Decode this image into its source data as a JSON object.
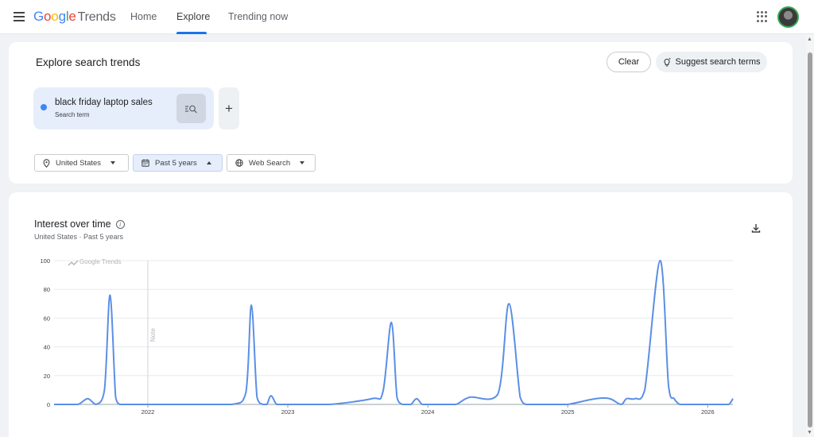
{
  "header": {
    "logo_google": "Google",
    "logo_trends": "Trends",
    "tabs": [
      {
        "label": "Home"
      },
      {
        "label": "Explore"
      },
      {
        "label": "Trending now"
      }
    ],
    "active_tab": "Explore"
  },
  "explore": {
    "title": "Explore search trends",
    "clear_label": "Clear",
    "suggest_label": "Suggest search terms",
    "term": {
      "text": "black friday laptop sales",
      "subtitle": "Search term",
      "color": "#4285f4"
    },
    "filters": {
      "location": "United States",
      "period": "Past 5 years",
      "property": "Web Search"
    }
  },
  "interest": {
    "title": "Interest over time",
    "subtitle": "United States · Past 5 years",
    "watermark": "Google Trends",
    "note_label": "Note"
  },
  "colors": {
    "accent": "#1a73e8",
    "series": "#5b8fe6",
    "grid": "#e8eaed"
  },
  "chart_data": {
    "type": "line",
    "ylim": [
      0,
      100
    ],
    "yticks": [
      0,
      20,
      40,
      60,
      80,
      100
    ],
    "xticks": [
      "2022",
      "2023",
      "2024",
      "2025",
      "2026"
    ],
    "series": [
      {
        "x": [
          2021.33,
          2021.4,
          2021.5,
          2021.57,
          2021.63,
          2021.69,
          2021.73,
          2021.77,
          2021.8,
          2021.83,
          2021.87,
          2021.92,
          2022.0,
          2022.3,
          2022.6,
          2022.7,
          2022.74,
          2022.78,
          2022.82,
          2022.85,
          2022.88,
          2022.92,
          2022.96,
          2023.0,
          2023.04,
          2023.08,
          2023.3,
          2023.6,
          2023.68,
          2023.74,
          2023.78,
          2023.82,
          2023.85,
          2023.88,
          2023.92,
          2023.96,
          2024.0,
          2024.04,
          2024.1,
          2024.2,
          2024.3,
          2024.5,
          2024.58,
          2024.66,
          2024.7,
          2024.74,
          2024.78,
          2024.82,
          2024.86,
          2024.92,
          2025.0,
          2025.2,
          2025.3,
          2025.38,
          2025.42,
          2025.48,
          2025.55,
          2025.66,
          2025.72,
          2025.76,
          2025.8,
          2025.84,
          2025.88,
          2025.94,
          2026.0,
          2026.1,
          2026.15,
          2026.18
        ],
        "y": [
          0,
          0,
          0,
          4,
          0,
          10,
          76,
          5,
          0,
          0,
          0,
          0,
          0,
          0,
          0,
          8,
          69,
          5,
          0,
          0,
          6,
          0,
          0,
          0,
          0,
          0,
          0,
          4,
          9,
          57,
          5,
          0,
          0,
          0,
          4,
          0,
          0,
          0,
          0,
          0,
          5,
          7,
          70,
          5,
          0,
          0,
          0,
          0,
          0,
          0,
          0,
          4,
          4,
          0,
          4,
          4,
          10,
          100,
          13,
          4,
          0,
          0,
          0,
          0,
          0,
          0,
          0,
          4
        ]
      }
    ]
  }
}
